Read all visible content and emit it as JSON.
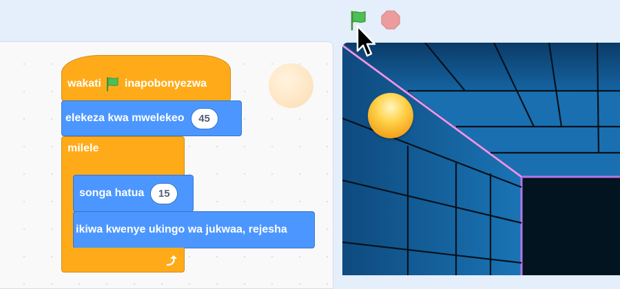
{
  "toolbar": {
    "green_flag_icon": "green-flag-icon",
    "stop_icon": "stop-sign-icon",
    "flag_color": "#4cbf56",
    "stop_color": "#ec9c9c"
  },
  "script": {
    "when_flag": {
      "label_before": "wakati",
      "label_after": "inapobonyezwa"
    },
    "point_direction": {
      "label": "elekeza kwa mwelekeo",
      "value": "45"
    },
    "forever": {
      "label": "milele"
    },
    "move": {
      "label": "songa hatua",
      "value": "15"
    },
    "bounce": {
      "label": "ikiwa kwenye ukingo wa jukwaa, rejesha"
    }
  },
  "colors": {
    "events": "#ffab19",
    "control": "#ffab19",
    "motion": "#4c97ff",
    "stage_bg": "#0d3a66",
    "ball": "#ffc93a"
  }
}
